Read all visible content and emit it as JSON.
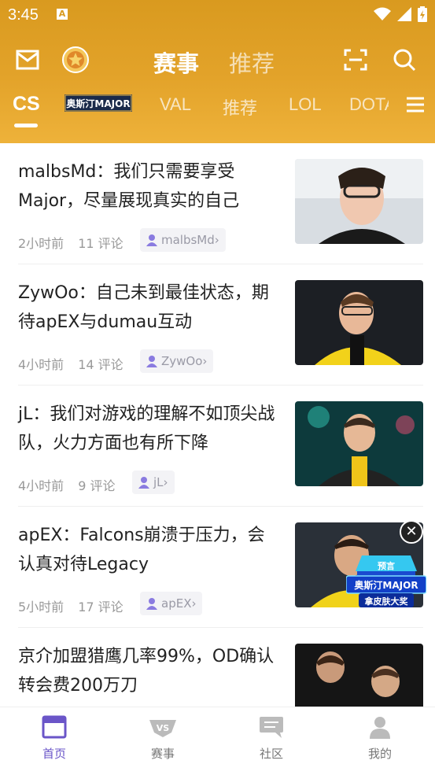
{
  "status_bar": {
    "time": "3:45",
    "sim_badge": "A"
  },
  "top_tabs": [
    {
      "label": "赛事",
      "active": true
    },
    {
      "label": "推荐",
      "active": false
    }
  ],
  "game_tabs": [
    {
      "label": "CS",
      "active": true
    },
    {
      "label": "奥斯汀MAJOR",
      "badge": true
    },
    {
      "label": "VAL"
    },
    {
      "label": "推荐"
    },
    {
      "label": "LOL"
    },
    {
      "label": "DOTA"
    }
  ],
  "articles": [
    {
      "title": "malbsMd：我们只需要享受Major，尽量展现真实的自己",
      "time": "2小时前",
      "comments": "11 评论",
      "author": "malbsMd"
    },
    {
      "title": "ZywOo：自己未到最佳状态，期待apEX与dumau互动",
      "time": "4小时前",
      "comments": "14 评论",
      "author": "ZywOo"
    },
    {
      "title": "jL：我们对游戏的理解不如顶尖战队，火力方面也有所下降",
      "time": "4小时前",
      "comments": "9 评论",
      "author": "jL"
    },
    {
      "title": "apEX：Falcons崩溃于压力，会认真对待Legacy",
      "time": "5小时前",
      "comments": "17 评论",
      "author": "apEX"
    },
    {
      "title": "京介加盟猎鹰几率99%，OD确认转会费200万刀"
    }
  ],
  "promo": {
    "line1": "预言",
    "line2": "奥斯汀MAJOR",
    "line3": "拿皮肤大奖"
  },
  "bottom_nav": [
    {
      "label": "首页",
      "active": true
    },
    {
      "label": "赛事"
    },
    {
      "label": "社区"
    },
    {
      "label": "我的"
    }
  ],
  "colors": {
    "header": "#e3a32a",
    "accent": "#6a55c8"
  }
}
